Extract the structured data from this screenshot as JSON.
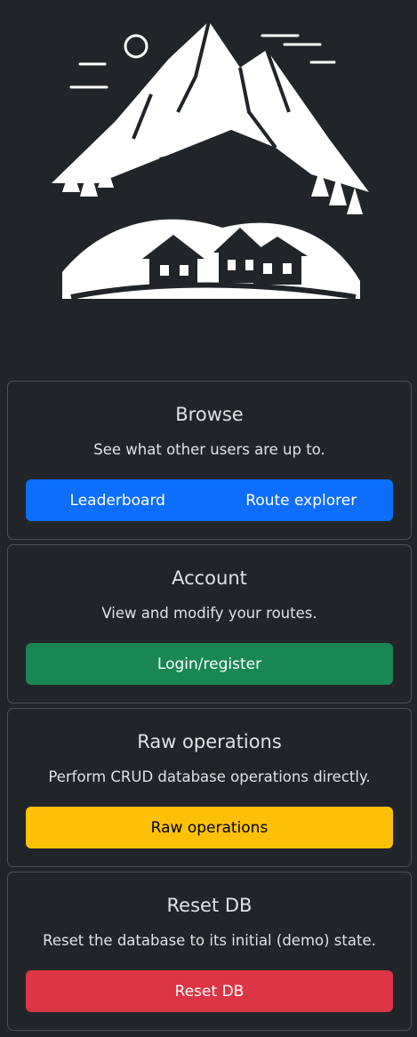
{
  "logo": {
    "icon": "mountain-village-icon"
  },
  "cards": [
    {
      "title": "Browse",
      "text": "See what other users are up to.",
      "buttons": [
        {
          "label": "Leaderboard"
        },
        {
          "label": "Route explorer"
        }
      ],
      "color": "#0d6efd"
    },
    {
      "title": "Account",
      "text": "View and modify your routes.",
      "buttons": [
        {
          "label": "Login/register"
        }
      ],
      "color": "#198754"
    },
    {
      "title": "Raw operations",
      "text": "Perform CRUD database operations directly.",
      "buttons": [
        {
          "label": "Raw operations"
        }
      ],
      "color": "#ffc107"
    },
    {
      "title": "Reset DB",
      "text": "Reset the database to its initial (demo) state.",
      "buttons": [
        {
          "label": "Reset DB"
        }
      ],
      "color": "#dc3545"
    }
  ]
}
